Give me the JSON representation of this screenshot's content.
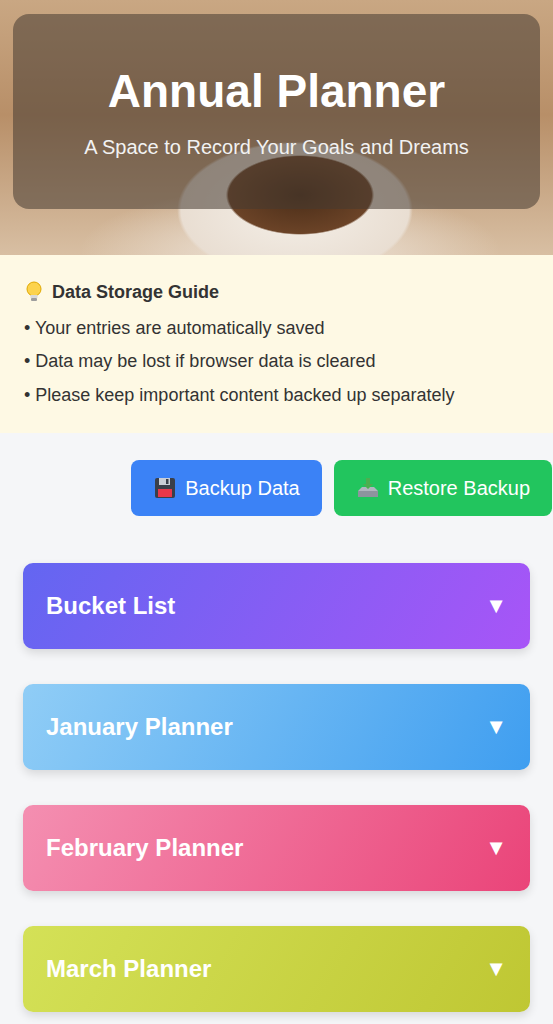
{
  "header": {
    "title": "Annual Planner",
    "subtitle": "A Space to Record Your Goals and Dreams"
  },
  "guide": {
    "title": "Data Storage Guide",
    "items": [
      "• Your entries are automatically saved",
      "• Data may be lost if browser data is cleared",
      "• Please keep important content backed up separately"
    ]
  },
  "buttons": [
    {
      "label": "Backup Data",
      "color": "#3b82f6"
    },
    {
      "label": "Restore Backup",
      "color": "#22c55e"
    }
  ],
  "sections": [
    {
      "title": "Bucket List",
      "toggle": "▼",
      "expanded": false,
      "color": "#6366f1",
      "color_end": "#a855f7"
    },
    {
      "title": "January Planner",
      "toggle": "▼",
      "expanded": false,
      "color": "#90cdf6",
      "color_end": "#3f9ef0"
    },
    {
      "title": "February Planner",
      "toggle": "▼",
      "expanded": false,
      "color": "#f48fb1",
      "color_end": "#ea4479"
    },
    {
      "title": "March Planner",
      "toggle": "▼",
      "expanded": false,
      "color": "#d4e157",
      "color_end": "#bfc733"
    }
  ]
}
